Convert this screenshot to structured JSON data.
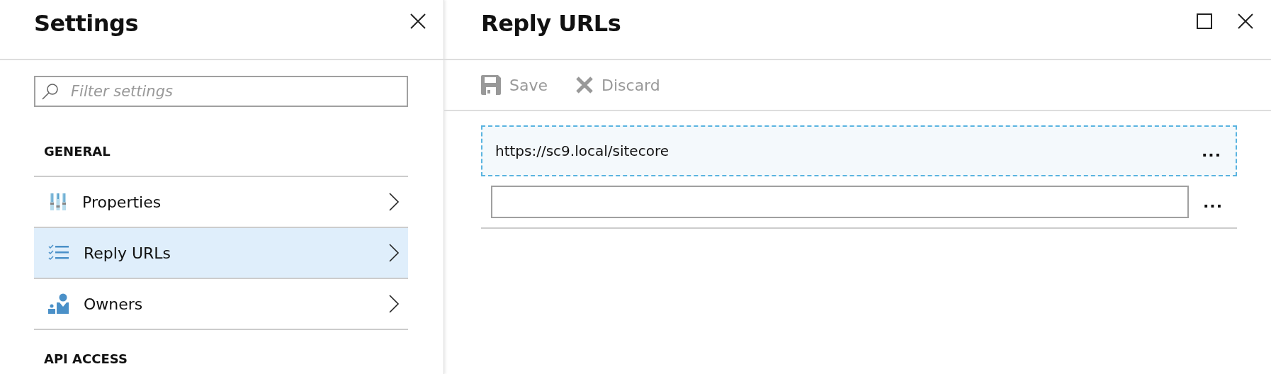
{
  "settings_panel": {
    "title": "Settings",
    "filter": {
      "placeholder": "Filter settings"
    },
    "sections": [
      {
        "heading": "GENERAL",
        "items": [
          {
            "label": "Properties",
            "kind": "properties",
            "selected": false
          },
          {
            "label": "Reply URLs",
            "kind": "urls",
            "selected": true
          },
          {
            "label": "Owners",
            "kind": "owners",
            "selected": false
          }
        ]
      },
      {
        "heading": "API ACCESS"
      }
    ]
  },
  "reply_urls_panel": {
    "title": "Reply URLs",
    "toolbar": [
      {
        "label": "Save",
        "kind": "save",
        "disabled": true
      },
      {
        "label": "Discard",
        "kind": "discard",
        "disabled": true
      }
    ],
    "urls": [
      {
        "kind": "entry",
        "value": "https://sc9.local/sitecore",
        "selected": true,
        "menu": "..."
      },
      {
        "kind": "input",
        "menu": "..."
      }
    ]
  }
}
